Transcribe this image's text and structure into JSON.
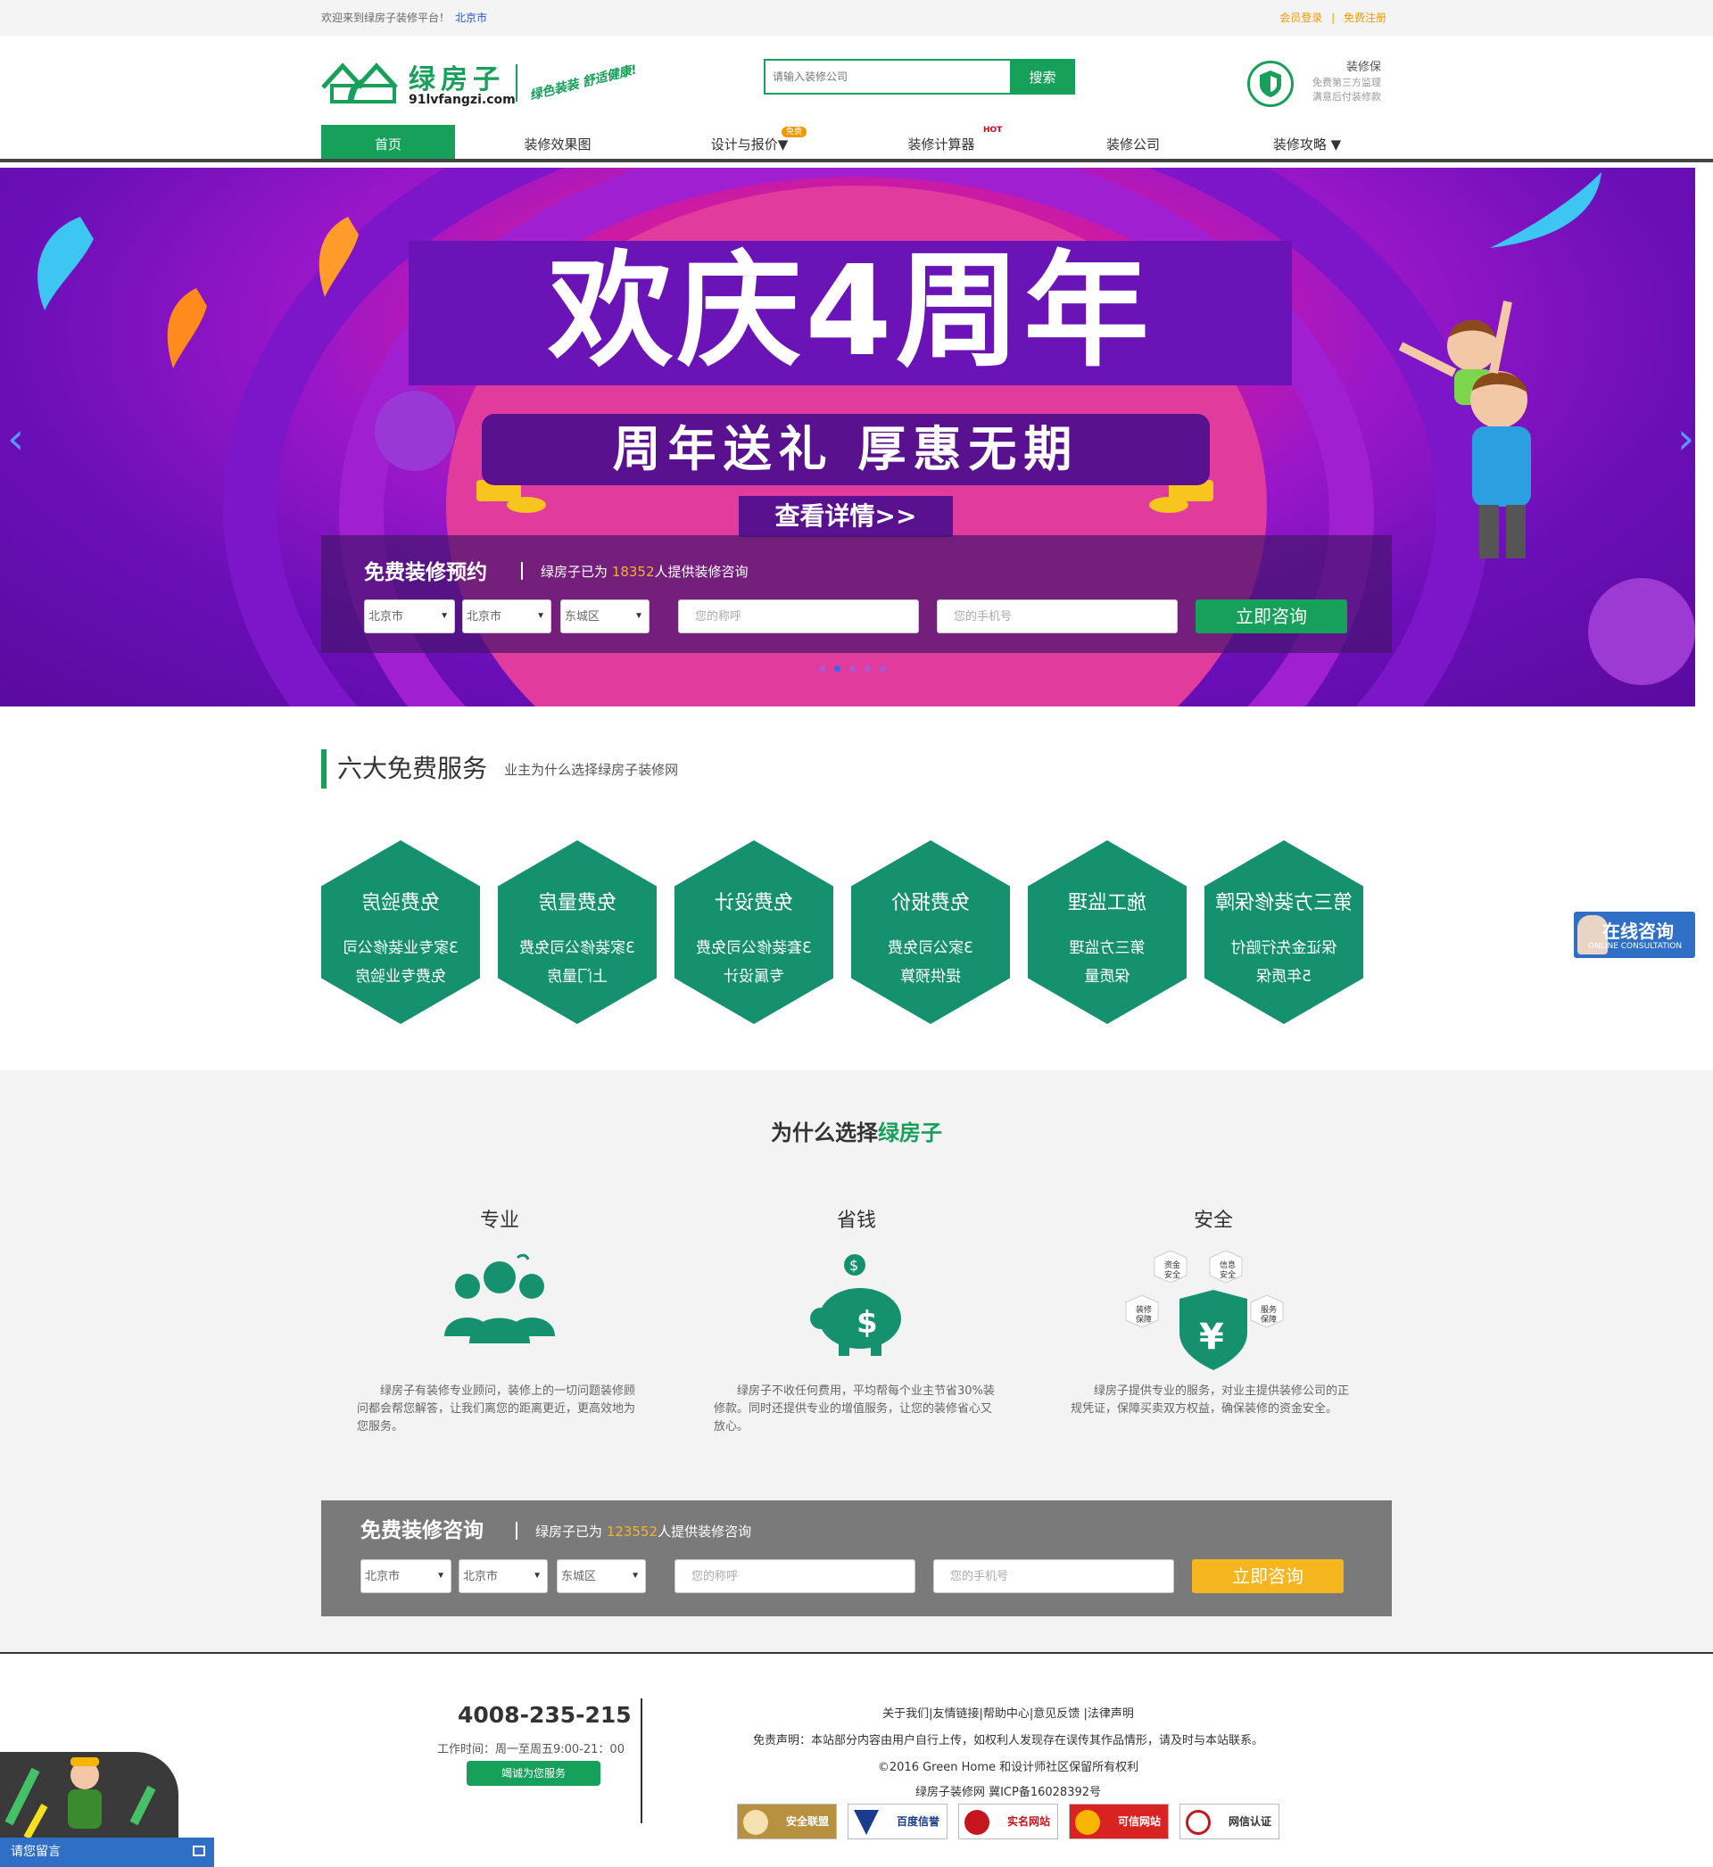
{
  "topbar": {
    "welcome": "欢迎来到绿房子装修平台！",
    "city": "北京市",
    "login": "会员登录",
    "sep": "|",
    "register": "免费注册"
  },
  "logo": {
    "name": "绿房子",
    "domain": "91lvfangzi.com",
    "slogan": "绿色装装 舒适健康!"
  },
  "search": {
    "placeholder": "请输入装修公司",
    "button": "搜索"
  },
  "guarantee": {
    "title": "装修保",
    "line1": "免费第三方监理",
    "line2": "满意后付装修款"
  },
  "nav": {
    "items": [
      {
        "label": "首页"
      },
      {
        "label": "装修效果图"
      },
      {
        "label": "设计与报价▼",
        "badge": "免费"
      },
      {
        "label": "装修计算器",
        "badge": "HOT"
      },
      {
        "label": "装修公司"
      },
      {
        "label": "装修攻略 ▼"
      }
    ]
  },
  "banner": {
    "title": "欢庆4周年",
    "subtitle": "周年送礼 厚惠无期",
    "cta": "查看详情>>",
    "prev": "‹",
    "next": "›"
  },
  "booking": {
    "title": "免费装修预约",
    "desc_prefix": "绿房子已为",
    "count": "18352",
    "desc_suffix": "人提供装修咨询",
    "province": "北京市",
    "city": "北京市",
    "district": "东城区",
    "name_placeholder": "您的称呼",
    "phone_placeholder": "您的手机号",
    "submit": "立即咨询"
  },
  "services": {
    "title": "六大免费服务",
    "subtitle": "业主为什么选择绿房子装修网",
    "items": [
      {
        "name": "免费验房",
        "line1": "3家专业装修公司",
        "line2": "免费专业验房"
      },
      {
        "name": "免费量房",
        "line1": "3家装修公司免费",
        "line2": "上门量房"
      },
      {
        "name": "免费设计",
        "line1": "3套装修公司免费",
        "line2": "专属设计"
      },
      {
        "name": "免费报价",
        "line1": "3家公司免费",
        "line2": "提供预算"
      },
      {
        "name": "施工监理",
        "line1": "第三方监理",
        "line2": "保质量"
      },
      {
        "name": "第三方装修保障",
        "line1": "保证金先行赔付",
        "line2": "5年质保"
      }
    ]
  },
  "why": {
    "title_prefix": "为什么选择",
    "title_brand": "绿房子",
    "cols": [
      {
        "title": "专业",
        "desc": "绿房子有装修专业顾问，装修上的一切问题装修顾问都会帮您解答，让我们离您的距离更近，更高效地为您服务。"
      },
      {
        "title": "省钱",
        "desc": "绿房子不收任何费用，平均帮每个业主节省30%装修款。同时还提供专业的增值服务，让您的装修省心又放心。"
      },
      {
        "title": "安全",
        "desc": "绿房子提供专业的服务，对业主提供装修公司的正规凭证，保障买卖双方权益，确保装修的资金安全。",
        "tags": [
          "资金安全",
          "信息安全",
          "装修保障",
          "服务保障"
        ]
      }
    ]
  },
  "consult": {
    "title": "免费装修咨询",
    "desc_prefix": "绿房子已为",
    "count": "123552",
    "desc_suffix": "人提供装修咨询",
    "province": "北京市",
    "city": "北京市",
    "district": "东城区",
    "name_placeholder": "您的称呼",
    "phone_placeholder": "您的手机号",
    "submit": "立即咨询"
  },
  "footer": {
    "phone": "4008-235-215",
    "hours": "工作时间：周一至周五9:00-21：00",
    "serve": "竭诚为您服务",
    "links": "关于我们|友情链接|帮助中心|意见反馈 |法律声明",
    "disclaimer": "免责声明：本站部分内容由用户自行上传，如权利人发现存在误传其作品情形，请及时与本站联系。",
    "copyright": "©2016 Green Home 和设计师社区保留所有权利",
    "icp": "绿房子装修网 冀ICP备16028392号",
    "certs": [
      "安全联盟",
      "百度信誉",
      "实名网站",
      "可信网站",
      "网信认证"
    ]
  },
  "float": {
    "online_cn": "在线咨询",
    "online_en": "ONLINE CONSULTATION",
    "leave": "请您留言"
  },
  "colors": {
    "brand": "#16a05a",
    "hex": "#16916f",
    "orange": "#f39800",
    "consult_btn": "#f5b51f",
    "panel_gray": "#7a7a7a"
  }
}
